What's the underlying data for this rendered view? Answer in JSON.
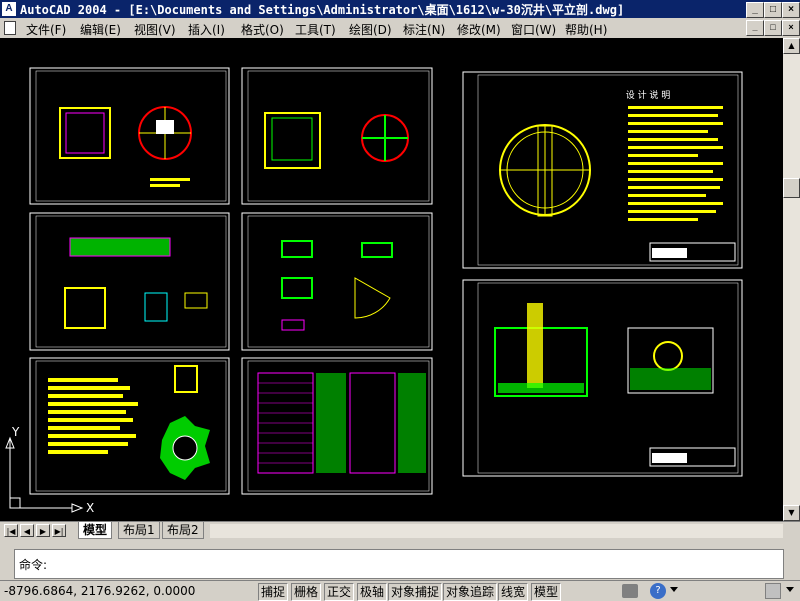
{
  "window": {
    "title": "AutoCAD 2004 - [E:\\Documents and Settings\\Administrator\\桌面\\1612\\w-30沉井\\平立剖.dwg]",
    "app_icon": "A",
    "controls": [
      "_",
      "□",
      "×"
    ]
  },
  "menubar": {
    "items": [
      "文件(F)",
      "编辑(E)",
      "视图(V)",
      "插入(I)",
      "格式(O)",
      "工具(T)",
      "绘图(D)",
      "标注(N)",
      "修改(M)",
      "窗口(W)",
      "帮助(H)"
    ],
    "doc_controls": [
      "_",
      "□",
      "×"
    ]
  },
  "drawing": {
    "ucs": {
      "x_label": "X",
      "y_label": "Y"
    },
    "sheet_titles": {
      "design_notes": "设 计 说 明"
    }
  },
  "layout_tabs": {
    "items": [
      "模型",
      "布局1",
      "布局2"
    ],
    "active": "模型"
  },
  "command": {
    "prompt": "命令:"
  },
  "status": {
    "coords": "-8796.6864, 2176.9262, 0.0000",
    "toggles": [
      "捕捉",
      "栅格",
      "正交",
      "极轴",
      "对象捕捉",
      "对象追踪",
      "线宽",
      "模型"
    ]
  },
  "colors": {
    "canvas": "#000000",
    "title_bar": "#0a246a",
    "chrome": "#d4d0c8"
  }
}
